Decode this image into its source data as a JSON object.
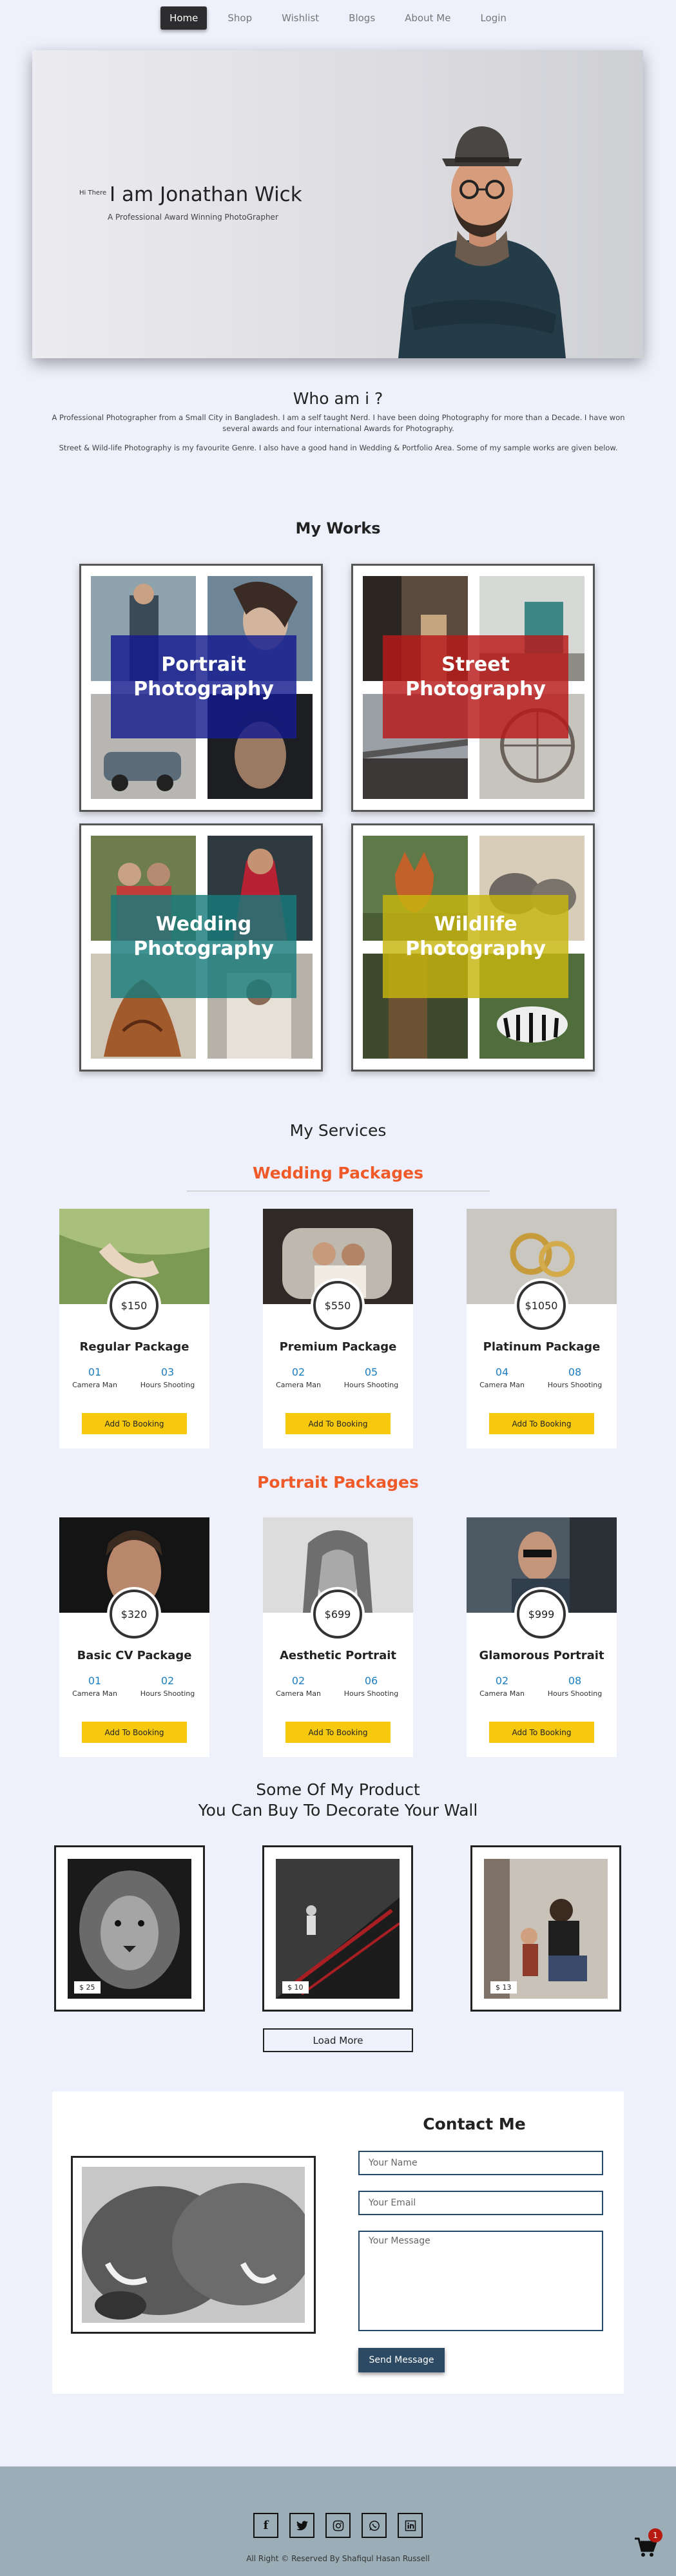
{
  "nav": {
    "items": [
      "Home",
      "Shop",
      "Wishlist",
      "Blogs",
      "About Me",
      "Login"
    ],
    "active": "Home"
  },
  "hero": {
    "greeting": "Hi There",
    "name": "I am Jonathan Wick",
    "subtitle": "A Professional Award Winning PhotoGrapher"
  },
  "about": {
    "title": "Who am i ?",
    "paragraph1": "A Professional Photographer from a Small City in Bangladesh. I am a self taught Nerd. I have been doing Photography for more than a Decade. I have won several awards and four international Awards for Photography.",
    "paragraph2": "Street & Wild-life Photography is my favourite Genre. I also have a good hand in Wedding & Portfolio Area. Some of my sample works are given below."
  },
  "works": {
    "title": "My Works",
    "items": [
      {
        "line1": "Portrait",
        "line2": "Photography",
        "color": "#131b8d"
      },
      {
        "line1": "Street",
        "line2": "Photography",
        "color": "#b81818"
      },
      {
        "line1": "Wedding",
        "line2": "Photography",
        "color": "#177b7b"
      },
      {
        "line1": "Wildlife",
        "line2": "Photography",
        "color": "#c7b60d"
      }
    ]
  },
  "services": {
    "title": "My Services",
    "wedding": {
      "title": "Wedding Packages",
      "cards": [
        {
          "price": "$150",
          "title": "Regular Package",
          "cameramen": "01",
          "hours": "03"
        },
        {
          "price": "$550",
          "title": "Premium Package",
          "cameramen": "02",
          "hours": "05"
        },
        {
          "price": "$1050",
          "title": "Platinum Package",
          "cameramen": "04",
          "hours": "08"
        }
      ]
    },
    "portrait": {
      "title": "Portrait Packages",
      "cards": [
        {
          "price": "$320",
          "title": "Basic CV Package",
          "cameramen": "01",
          "hours": "02"
        },
        {
          "price": "$699",
          "title": "Aesthetic Portrait",
          "cameramen": "02",
          "hours": "06"
        },
        {
          "price": "$999",
          "title": "Glamorous Portrait",
          "cameramen": "02",
          "hours": "08"
        }
      ]
    },
    "labels": {
      "cameramen": "Camera Man",
      "hours": "Hours Shooting",
      "book": "Add To Booking"
    }
  },
  "products": {
    "title_line1": "Some Of My Product",
    "title_line2": "You Can Buy To Decorate Your Wall",
    "items": [
      {
        "price": "$ 25"
      },
      {
        "price": "$ 10"
      },
      {
        "price": "$ 13"
      }
    ],
    "load_more": "Load More"
  },
  "contact": {
    "title": "Contact Me",
    "name_placeholder": "Your Name",
    "email_placeholder": "Your Email",
    "message_placeholder": "Your Message",
    "send": "Send Message"
  },
  "footer": {
    "copyright": "All Right © Reserved By Shafiqul Hasan Russell",
    "socials": [
      "facebook-icon",
      "twitter-icon",
      "instagram-icon",
      "whatsapp-icon",
      "linkedin-icon"
    ]
  },
  "cart": {
    "count": "1"
  }
}
